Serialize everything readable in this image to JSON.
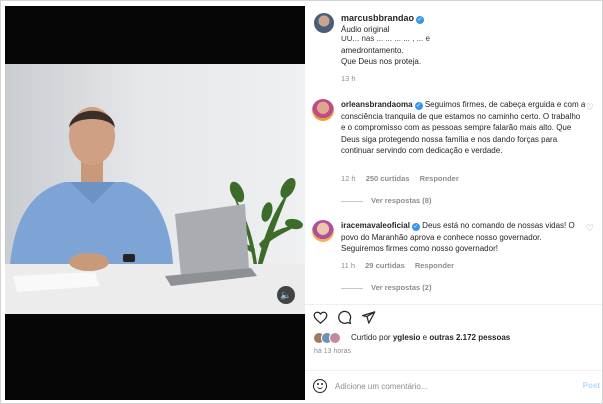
{
  "post": {
    "username": "marcusbbrandao",
    "audio": "Áudio original"
  },
  "comments": [
    {
      "username": "",
      "text": "...  nas ...  ... , ... , ...  e amedrontamento. Que Deus nos proteja.",
      "time": "13 h"
    },
    {
      "username": "orleansbrandaoma",
      "text": "Seguimos firmes, de cabeça erguida e com a consciência tranquila de que estamos no caminho certo. O trabalho e o compromisso com as pessoas sempre falarão mais alto. Que Deus siga protegendo nossa família e nos dando forças para continuar servindo com dedicação e verdade.",
      "time": "12 h",
      "likes": "250 curtidas",
      "reply": "Responder",
      "view_replies": "Ver respostas (8)"
    },
    {
      "username": "iracemavaleoficial",
      "text": "Deus está no comando de nossas vidas! O povo do Maranhão aprova e conhece nosso governador. Seguiremos firmes como nosso governador!",
      "time": "11 h",
      "likes": "29 curtidas",
      "reply": "Responder",
      "view_replies": "Ver respostas (2)"
    }
  ],
  "likes_bar": {
    "prefix": "Curtido por",
    "user": "yglesio",
    "connector": "e",
    "others": "outras 2.172 pessoas"
  },
  "posted_ago": "há 13 horas",
  "comment_box": {
    "placeholder": "Adicione um comentário...",
    "post_label": "Post"
  },
  "icons": {
    "like": "heart-icon",
    "comment": "comment-icon",
    "share": "send-icon",
    "emoji": "emoji-icon",
    "mute": "speaker-icon"
  },
  "colors": {
    "verified": "#3897f0",
    "muted_text": "#8e8e8e",
    "post_button": "#b3dbff"
  }
}
